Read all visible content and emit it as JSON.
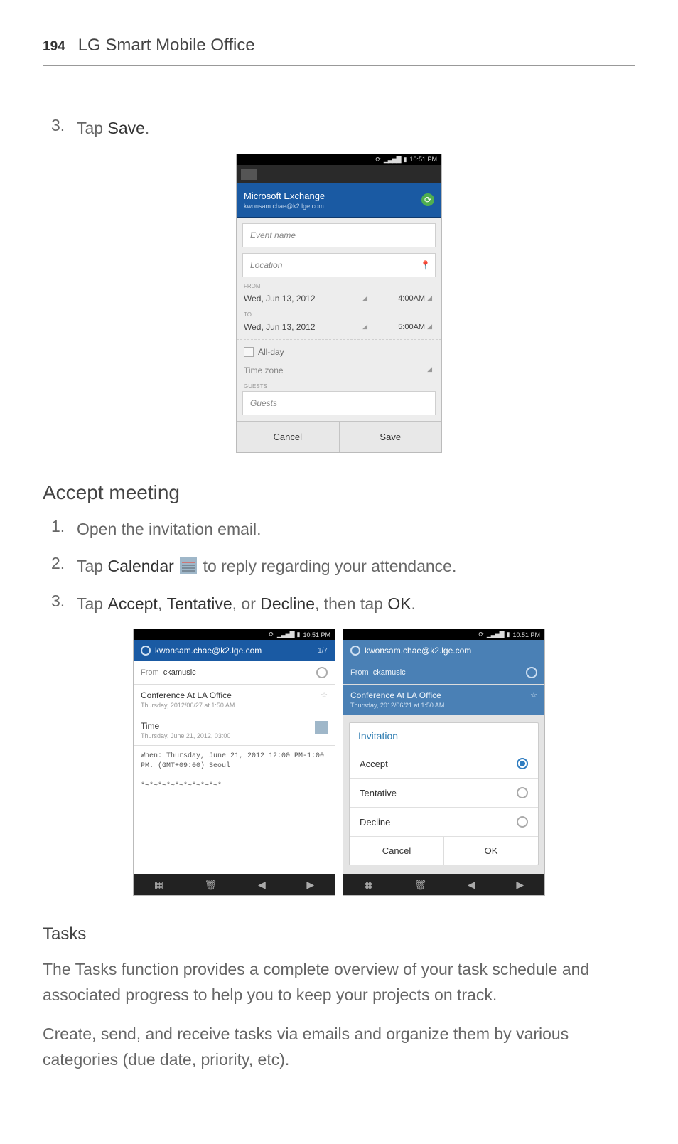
{
  "page": {
    "number": "194",
    "section": "LG Smart Mobile Office"
  },
  "step_intro": {
    "num": "3.",
    "prefix": "Tap ",
    "bold": "Save",
    "suffix": "."
  },
  "accept_heading": "Accept meeting",
  "accept_steps": {
    "s1": {
      "num": "1.",
      "text": "Open the invitation email."
    },
    "s2": {
      "num": "2.",
      "prefix": "Tap ",
      "bold": "Calendar",
      "suffix": " to reply regarding your attendance."
    },
    "s3": {
      "num": "3.",
      "prefix": "Tap ",
      "b1": "Accept",
      "c1": ", ",
      "b2": "Tentative",
      "c2": ", or ",
      "b3": "Decline",
      "c3": ", then tap ",
      "b4": "OK",
      "suffix": "."
    }
  },
  "tasks_heading": "Tasks",
  "tasks_p1": "The Tasks function provides a complete overview of your task schedule and associated progress to help you to keep your projects on track.",
  "tasks_p2": "Create, send, and receive tasks via emails and organize them by various categories (due date, priority, etc).",
  "shot1": {
    "time": "10:51 PM",
    "account_title": "Microsoft Exchange",
    "account_sub": "kwonsam.chae@k2.lge.com",
    "event_name_ph": "Event name",
    "location_ph": "Location",
    "from_label": "FROM",
    "from_date": "Wed, Jun 13, 2012",
    "from_time": "4:00AM",
    "to_label": "TO",
    "to_date": "Wed, Jun 13, 2012",
    "to_time": "5:00AM",
    "allday": "All-day",
    "timezone": "Time zone",
    "guests_label": "GUESTS",
    "guests_ph": "Guests",
    "cancel": "Cancel",
    "save": "Save"
  },
  "shot2a": {
    "time": "10:51 PM",
    "title": "kwonsam.chae@k2.lge.com",
    "page": "1/7",
    "from_label": "From",
    "from_val": "ckamusic",
    "subject": "Conference At LA Office",
    "subject_sub": "Thursday, 2012/06/27 at 1:50 AM",
    "time_label": "Time",
    "time_val": "Thursday, June 21, 2012, 03:00",
    "body_line1": "When: Thursday, June 21, 2012 12:00 PM-1:00",
    "body_line2": "PM. (GMT+09:00) Seoul",
    "body_line3": "*~*~*~*~*~*~*~*~*~*"
  },
  "shot2b": {
    "time": "10:51 PM",
    "title": "kwonsam.chae@k2.lge.com",
    "from_label": "From",
    "from_val": "ckamusic",
    "subject": "Conference At LA Office",
    "subject_sub": "Thursday, 2012/06/21 at 1:50 AM",
    "dialog_title": "Invitation",
    "opt_accept": "Accept",
    "opt_tentative": "Tentative",
    "opt_decline": "Decline",
    "btn_cancel": "Cancel",
    "btn_ok": "OK"
  }
}
